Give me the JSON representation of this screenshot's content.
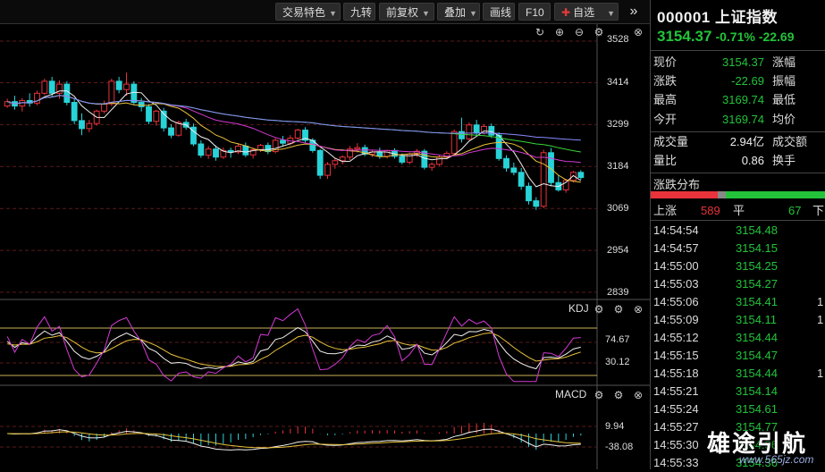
{
  "toolbar": {
    "buttons": [
      "交易特色",
      "九转",
      "前复权",
      "叠加",
      "画线",
      "F10"
    ],
    "favorite_label": "自选",
    "more_icon": "double-chevron-right-icon"
  },
  "stock": {
    "code_name": "000001 上证指数",
    "price": "3154.37",
    "change_pct": "-0.71%",
    "change": "-22.69"
  },
  "quote_rows": [
    {
      "l1": "现价",
      "v": "3154.37",
      "l2": "涨幅"
    },
    {
      "l1": "涨跌",
      "v": "-22.69",
      "l2": "振幅"
    },
    {
      "l1": "最高",
      "v": "3169.74",
      "l2": "最低"
    },
    {
      "l1": "今开",
      "v": "3169.74",
      "l2": "均价"
    },
    {
      "l1": "成交量",
      "v": "2.94亿",
      "l2": "成交额"
    },
    {
      "l1": "量比",
      "v": "0.86",
      "l2": "换手"
    }
  ],
  "distribution": {
    "title": "涨跌分布",
    "up_label": "上涨",
    "up_count": "589",
    "flat_label": "平",
    "flat_count": "67",
    "down_label": "下"
  },
  "ticks": [
    {
      "t": "14:54:54",
      "p": "3154.48",
      "v": ""
    },
    {
      "t": "14:54:57",
      "p": "3154.15",
      "v": ""
    },
    {
      "t": "14:55:00",
      "p": "3154.25",
      "v": ""
    },
    {
      "t": "14:55:03",
      "p": "3154.27",
      "v": ""
    },
    {
      "t": "14:55:06",
      "p": "3154.41",
      "v": "1"
    },
    {
      "t": "14:55:09",
      "p": "3154.11",
      "v": "1"
    },
    {
      "t": "14:55:12",
      "p": "3154.44",
      "v": ""
    },
    {
      "t": "14:55:15",
      "p": "3154.47",
      "v": ""
    },
    {
      "t": "14:55:18",
      "p": "3154.44",
      "v": "1"
    },
    {
      "t": "14:55:21",
      "p": "3154.14",
      "v": ""
    },
    {
      "t": "14:55:24",
      "p": "3154.61",
      "v": ""
    },
    {
      "t": "14:55:27",
      "p": "3154.77",
      "v": ""
    },
    {
      "t": "14:55:30",
      "p": "3154.36",
      "v": ""
    },
    {
      "t": "14:55:33",
      "p": "3154.36",
      "v": ""
    }
  ],
  "panes": {
    "kdj_label": "KDJ",
    "macd_label": "MACD",
    "price_axis": [
      "3528",
      "3414",
      "3299",
      "3184",
      "3069",
      "2954",
      "2839"
    ],
    "kdj_axis": [
      "74.67",
      "30.12"
    ],
    "macd_axis": [
      "9.94",
      "-38.08"
    ]
  },
  "colors": {
    "up": "#e8333b",
    "down": "#28d3d8",
    "green": "#23c33a"
  },
  "watermark": {
    "text": "雄途引航",
    "url": "www.565jz.com"
  },
  "chart_data": {
    "type": "candlestick",
    "ylim": [
      2839,
      3528
    ],
    "candles": [
      [
        3350,
        3370,
        3345,
        3362
      ],
      [
        3362,
        3378,
        3340,
        3350
      ],
      [
        3350,
        3372,
        3335,
        3365
      ],
      [
        3365,
        3385,
        3348,
        3358
      ],
      [
        3358,
        3392,
        3352,
        3385
      ],
      [
        3385,
        3425,
        3380,
        3418
      ],
      [
        3418,
        3430,
        3375,
        3385
      ],
      [
        3385,
        3420,
        3370,
        3410
      ],
      [
        3410,
        3418,
        3352,
        3360
      ],
      [
        3360,
        3372,
        3300,
        3310
      ],
      [
        3310,
        3330,
        3270,
        3288
      ],
      [
        3288,
        3312,
        3278,
        3302
      ],
      [
        3302,
        3340,
        3296,
        3336
      ],
      [
        3336,
        3365,
        3330,
        3356
      ],
      [
        3356,
        3425,
        3350,
        3418
      ],
      [
        3418,
        3430,
        3385,
        3395
      ],
      [
        3395,
        3442,
        3378,
        3410
      ],
      [
        3410,
        3418,
        3352,
        3360
      ],
      [
        3360,
        3372,
        3335,
        3348
      ],
      [
        3348,
        3355,
        3300,
        3308
      ],
      [
        3308,
        3340,
        3296,
        3336
      ],
      [
        3336,
        3345,
        3280,
        3290
      ],
      [
        3290,
        3300,
        3262,
        3270
      ],
      [
        3270,
        3310,
        3266,
        3305
      ],
      [
        3305,
        3315,
        3285,
        3292
      ],
      [
        3292,
        3302,
        3240,
        3246
      ],
      [
        3246,
        3256,
        3208,
        3215
      ],
      [
        3215,
        3240,
        3205,
        3232
      ],
      [
        3232,
        3242,
        3200,
        3210
      ],
      [
        3210,
        3236,
        3205,
        3228
      ],
      [
        3228,
        3236,
        3208,
        3224
      ],
      [
        3224,
        3248,
        3218,
        3240
      ],
      [
        3240,
        3250,
        3210,
        3216
      ],
      [
        3216,
        3236,
        3206,
        3230
      ],
      [
        3230,
        3246,
        3224,
        3242
      ],
      [
        3242,
        3250,
        3218,
        3225
      ],
      [
        3225,
        3262,
        3220,
        3256
      ],
      [
        3256,
        3268,
        3240,
        3248
      ],
      [
        3248,
        3270,
        3242,
        3262
      ],
      [
        3262,
        3288,
        3258,
        3284
      ],
      [
        3284,
        3292,
        3250,
        3256
      ],
      [
        3256,
        3262,
        3222,
        3228
      ],
      [
        3228,
        3232,
        3150,
        3160
      ],
      [
        3160,
        3196,
        3150,
        3190
      ],
      [
        3190,
        3206,
        3178,
        3200
      ],
      [
        3200,
        3215,
        3190,
        3210
      ],
      [
        3210,
        3240,
        3202,
        3232
      ],
      [
        3232,
        3248,
        3222,
        3236
      ],
      [
        3236,
        3244,
        3212,
        3218
      ],
      [
        3218,
        3230,
        3210,
        3224
      ],
      [
        3224,
        3236,
        3205,
        3212
      ],
      [
        3212,
        3230,
        3206,
        3228
      ],
      [
        3228,
        3234,
        3206,
        3212
      ],
      [
        3212,
        3220,
        3190,
        3196
      ],
      [
        3196,
        3222,
        3190,
        3218
      ],
      [
        3218,
        3232,
        3210,
        3226
      ],
      [
        3226,
        3232,
        3176,
        3182
      ],
      [
        3182,
        3196,
        3172,
        3190
      ],
      [
        3190,
        3215,
        3186,
        3210
      ],
      [
        3210,
        3226,
        3204,
        3220
      ],
      [
        3220,
        3286,
        3214,
        3280
      ],
      [
        3280,
        3318,
        3250,
        3260
      ],
      [
        3260,
        3305,
        3256,
        3298
      ],
      [
        3298,
        3312,
        3268,
        3276
      ],
      [
        3276,
        3300,
        3272,
        3294
      ],
      [
        3294,
        3302,
        3262,
        3270
      ],
      [
        3270,
        3278,
        3200,
        3206
      ],
      [
        3206,
        3215,
        3170,
        3180
      ],
      [
        3180,
        3195,
        3160,
        3168
      ],
      [
        3168,
        3180,
        3120,
        3130
      ],
      [
        3130,
        3140,
        3080,
        3090
      ],
      [
        3090,
        3100,
        3065,
        3075
      ],
      [
        3075,
        3230,
        3070,
        3222
      ],
      [
        3222,
        3235,
        3130,
        3140
      ],
      [
        3140,
        3160,
        3115,
        3120
      ],
      [
        3120,
        3150,
        3112,
        3146
      ],
      [
        3146,
        3172,
        3140,
        3168
      ],
      [
        3168,
        3174,
        3148,
        3154
      ]
    ]
  }
}
